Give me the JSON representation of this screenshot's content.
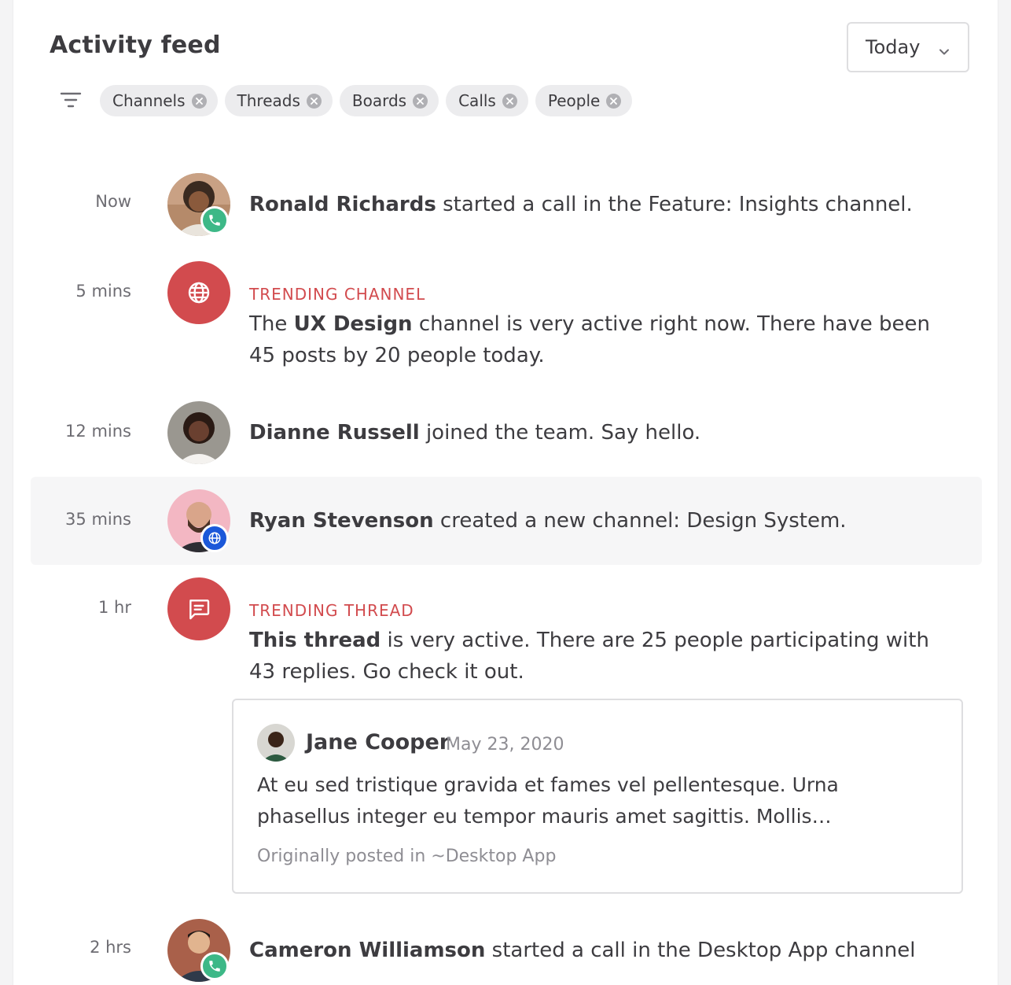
{
  "header": {
    "title": "Activity feed",
    "date_filter": "Today"
  },
  "filters": {
    "chips": [
      {
        "label": "Channels"
      },
      {
        "label": "Threads"
      },
      {
        "label": "Boards"
      },
      {
        "label": "Calls"
      },
      {
        "label": "People"
      }
    ]
  },
  "feed": {
    "items": [
      {
        "time": "Now",
        "actor": "Ronald Richards",
        "text": " started a call in the Feature: Insights channel.",
        "badge": "phone-icon"
      },
      {
        "time": "5 mins",
        "kicker": "TRENDING CHANNEL",
        "pre": "The ",
        "bold": "UX Design",
        "text": " channel is very active right now. There have been 45 posts by 20 people today.",
        "icon": "globe-icon"
      },
      {
        "time": "12 mins",
        "actor": "Dianne Russell",
        "text": " joined the team. Say hello."
      },
      {
        "time": "35 mins",
        "actor": "Ryan Stevenson",
        "text": " created a new channel: Design System.",
        "badge": "globe-icon",
        "highlighted": true
      },
      {
        "time": "1 hr",
        "kicker": "TRENDING THREAD",
        "bold": "This thread",
        "text": " is very active. There are 25 people participating with 43 replies. Go check it out.",
        "icon": "message-icon"
      },
      {
        "time": "2 hrs",
        "actor": "Cameron Williamson",
        "text": " started a call in the Desktop App channel",
        "badge": "phone-icon"
      }
    ],
    "quote": {
      "author": "Jane Cooper",
      "date": "May 23, 2020",
      "body": "At eu sed tristique gravida et fames vel pellentesque. Urna phasellus integer eu tempor mauris amet sagittis. Mollis…",
      "origin": "Originally posted in ~Desktop App"
    }
  },
  "colors": {
    "accent_red": "#d24b4e",
    "call_green": "#3db887",
    "channel_blue": "#1c58d9"
  }
}
